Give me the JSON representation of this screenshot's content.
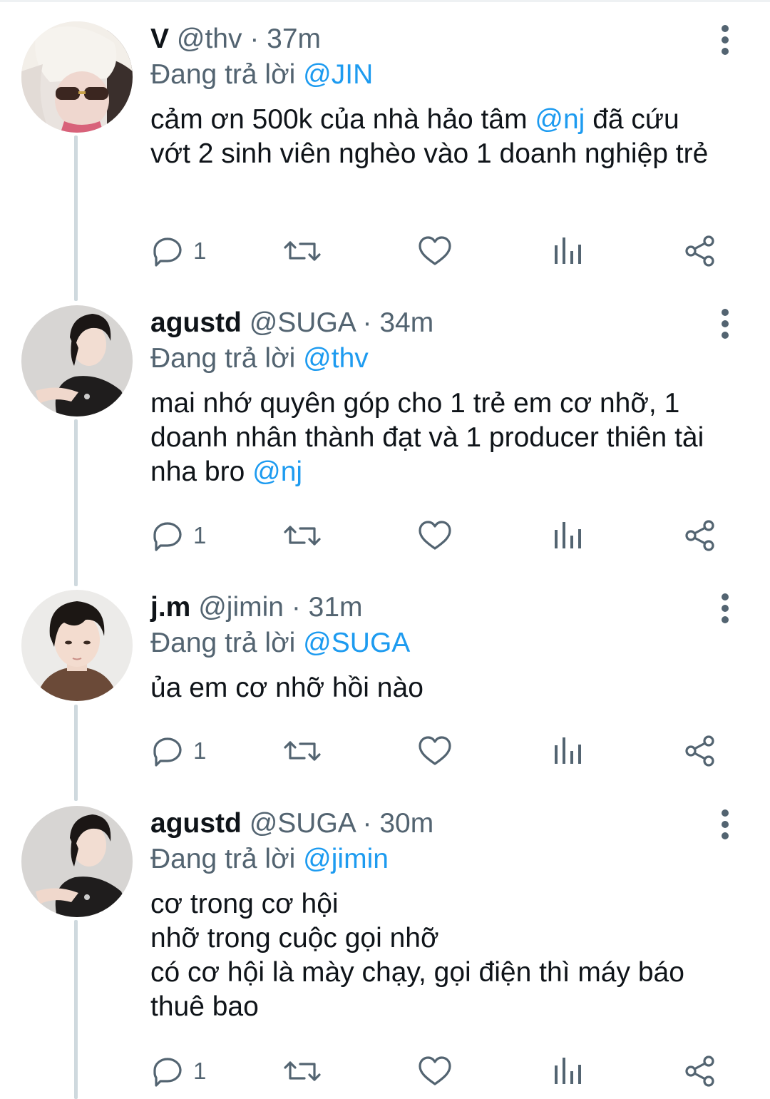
{
  "tweets": [
    {
      "display_name": "V",
      "handle": "@thv",
      "sep": "·",
      "time": "37m",
      "replying_prefix": "Đang trả lời ",
      "replying_to": "@JIN",
      "body_parts": [
        {
          "text": "cảm ơn 500k của nhà hảo tâm "
        },
        {
          "text": "@nj",
          "mention": true
        },
        {
          "text": " đã cứu vớt 2 sinh viên nghèo vào 1 doanh nghiệp trẻ"
        }
      ],
      "reply_count": "1",
      "avatar": "blonde-hair-sunglasses"
    },
    {
      "display_name": "agustd",
      "handle": "@SUGA",
      "sep": "·",
      "time": "34m",
      "replying_prefix": "Đang trả lời ",
      "replying_to": "@thv",
      "body_parts": [
        {
          "text": "mai nhớ quyên góp cho 1 trẻ em cơ nhỡ, 1 doanh nhân thành đạt và 1 producer thiên tài nha bro "
        },
        {
          "text": "@nj",
          "mention": true
        }
      ],
      "reply_count": "1",
      "avatar": "dark-hair-black-shirt"
    },
    {
      "display_name": "j.m",
      "handle": "@jimin",
      "sep": "·",
      "time": "31m",
      "replying_prefix": "Đang trả lời ",
      "replying_to": "@SUGA",
      "body_parts": [
        {
          "text": "ủa em cơ nhỡ hồi nào"
        }
      ],
      "reply_count": "1",
      "avatar": "black-hair-brown-sweater"
    },
    {
      "display_name": "agustd",
      "handle": "@SUGA",
      "sep": "·",
      "time": "30m",
      "replying_prefix": "Đang trả lời ",
      "replying_to": "@jimin",
      "body_parts": [
        {
          "text": "cơ trong cơ hội\nnhỡ trong cuộc gọi nhỡ\ncó cơ hội là mày chạy, gọi điện thì máy báo thuê bao"
        }
      ],
      "reply_count": "1",
      "avatar": "dark-hair-black-shirt"
    }
  ],
  "icons": {
    "reply": "reply-bubble-icon",
    "retweet": "retweet-icon",
    "like": "heart-icon",
    "views": "bar-chart-icon",
    "share": "share-icon",
    "more": "more-vertical-icon"
  },
  "colors": {
    "text": "#0f1419",
    "secondary": "#536471",
    "mention": "#1d9bf0",
    "thread_line": "#cfd9de"
  }
}
